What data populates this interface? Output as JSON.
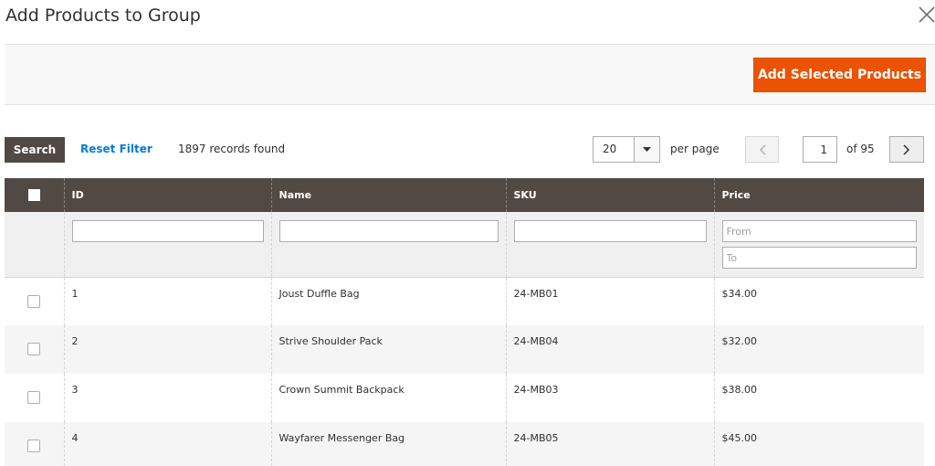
{
  "modal": {
    "title": "Add Products to Group",
    "close_icon": "close-icon"
  },
  "actions": {
    "add_selected_label": "Add Selected Products",
    "accent_color": "#eb5202"
  },
  "toolbar": {
    "search_label": "Search",
    "reset_label": "Reset Filter",
    "records_text": "1897 records found",
    "per_page_value": "20",
    "per_page_label": "per page",
    "current_page": "1",
    "page_of_text": "of 95"
  },
  "table": {
    "columns": [
      {
        "label": ""
      },
      {
        "label": "ID"
      },
      {
        "label": "Name"
      },
      {
        "label": "SKU"
      },
      {
        "label": "Price"
      }
    ],
    "filters": {
      "price_from_placeholder": "From",
      "price_to_placeholder": "To"
    },
    "rows": [
      {
        "id": "1",
        "name": "Joust Duffle Bag",
        "sku": "24-MB01",
        "price": "$34.00"
      },
      {
        "id": "2",
        "name": "Strive Shoulder Pack",
        "sku": "24-MB04",
        "price": "$32.00"
      },
      {
        "id": "3",
        "name": "Crown Summit Backpack",
        "sku": "24-MB03",
        "price": "$38.00"
      },
      {
        "id": "4",
        "name": "Wayfarer Messenger Bag",
        "sku": "24-MB05",
        "price": "$45.00"
      }
    ]
  },
  "colors": {
    "header_bg": "#514943",
    "link": "#007bdb",
    "button_primary": "#eb5202"
  }
}
